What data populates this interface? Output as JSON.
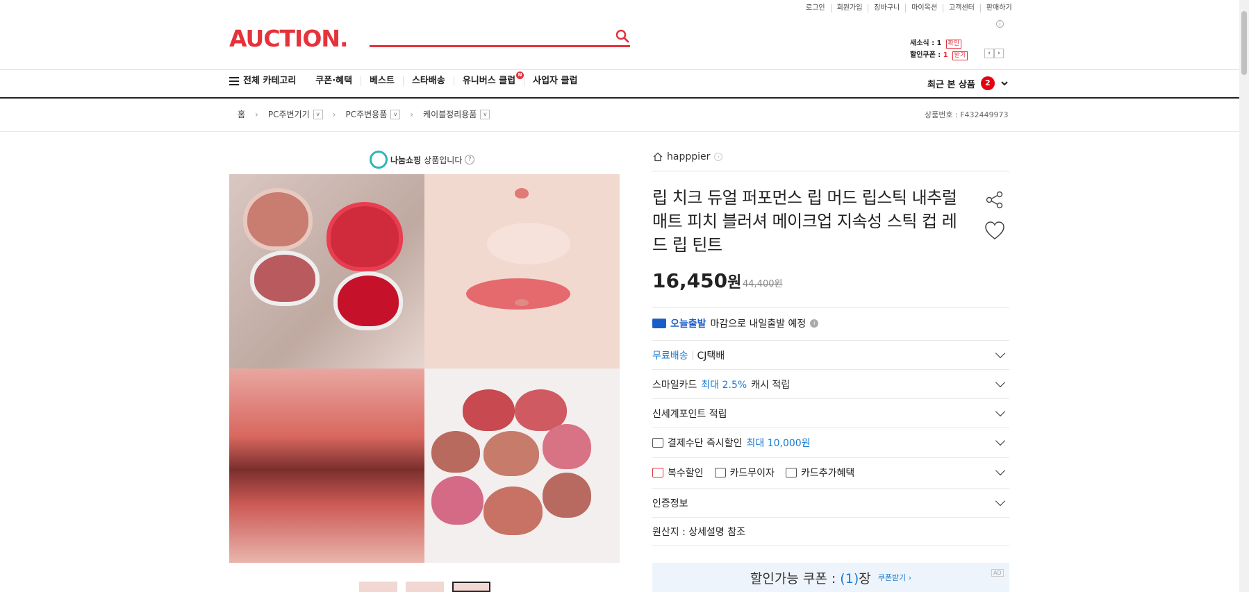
{
  "util_links": [
    "로그인",
    "회원가입",
    "장바구니",
    "마이옥션",
    "고객센터",
    "판매하기"
  ],
  "logo": "AUCTION.",
  "news": {
    "line1_label": "새소식 : 1",
    "line1_btn": "확인",
    "line2_label": "할인쿠폰 : ",
    "line2_count": "1",
    "line2_btn": "받기"
  },
  "nav": {
    "all_category": "전체 카테고리",
    "items": [
      "쿠폰·혜택",
      "베스트",
      "스타배송",
      "유니버스 클럽",
      "사업자 클럽"
    ],
    "universe_badge": "N",
    "recent_label": "최근 본 상품",
    "recent_count": "2"
  },
  "breadcrumb": {
    "home": "홈",
    "cat1": "PC주변기기",
    "cat2": "PC주변용품",
    "cat3": "케이블정리용품",
    "product_no": "상품번호 : F432449973"
  },
  "share_shopping": {
    "logo_text": "나눔쇼핑",
    "text": "상품입니다"
  },
  "seller": "happpier",
  "product": {
    "title": "립 치크 듀얼 퍼포먼스 립 머드 립스틱 내추럴 매트 피치 블러셔 메이크업 지속성 스틱 컵 레드 립 틴트",
    "price": "16,450",
    "won": "원",
    "original_price": "44,400원"
  },
  "today_ship": {
    "label": "오늘출발",
    "text": "마감으로 내일출발 예정"
  },
  "rows": {
    "shipping_free": "무료배송",
    "shipping_carrier": "CJ택배",
    "smile_a": "스마일카드",
    "smile_b": "최대 2.5%",
    "smile_c": "캐시 적립",
    "ssg_point": "신세계포인트 적립",
    "payment_a": "결제수단 즉시할인",
    "payment_b": "최대 10,000원",
    "multi_discount": "복수할인",
    "card_no_interest": "카드무이자",
    "card_extra": "카드추가혜택",
    "cert": "인증정보",
    "origin": "원산지 : 상세설명 참조"
  },
  "coupon": {
    "label": "할인가능 쿠폰 : ",
    "count_open": "(",
    "count": "1",
    "count_close": ")",
    "unit": "장",
    "get": "쿠폰받기 ›",
    "ad": "AD"
  },
  "colors": {
    "brand": "#e5323b",
    "link_blue": "#1a7bd3"
  }
}
